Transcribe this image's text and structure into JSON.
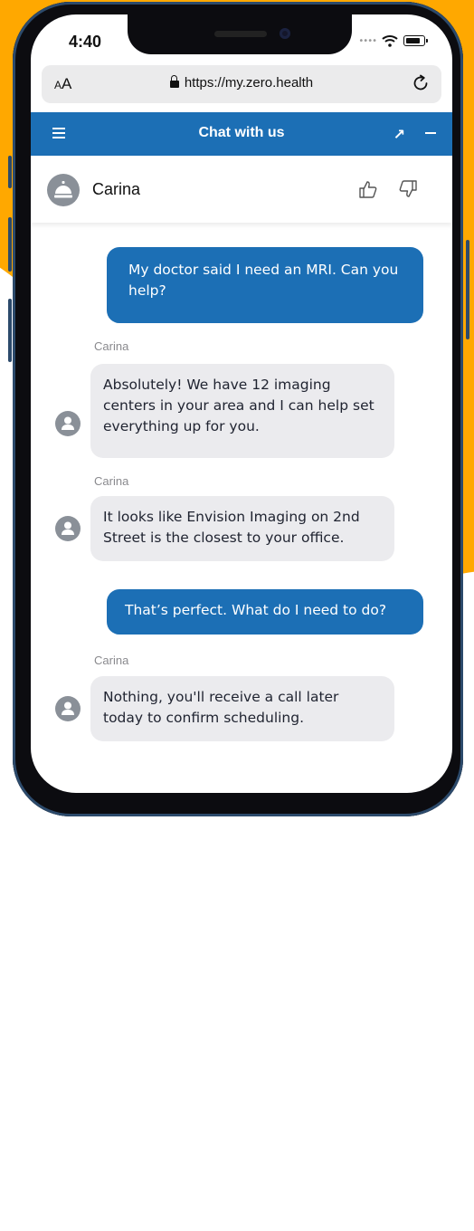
{
  "status_bar": {
    "time": "4:40"
  },
  "browser": {
    "text_size_label_small": "A",
    "text_size_label_large": "A",
    "url": "https://my.zero.health"
  },
  "chat_header": {
    "title": "Chat with us"
  },
  "agent": {
    "name": "Carina"
  },
  "messages": [
    {
      "from": "user",
      "text": "My doctor said I need an MRI. Can you help?"
    },
    {
      "from": "agent",
      "sender": "Carina",
      "text": "Absolutely! We have 12 imaging centers in your area and I can help set everything up for you."
    },
    {
      "from": "agent",
      "sender": "Carina",
      "text": "It looks like Envision Imaging on 2nd Street is the closest to your office."
    },
    {
      "from": "user",
      "text": "That’s perfect. What do I need to do?"
    },
    {
      "from": "agent",
      "sender": "Carina",
      "text": "Nothing, you'll receive a call later today to confirm scheduling."
    }
  ],
  "colors": {
    "background_accent": "#ffa800",
    "brand_blue": "#1c6fb5",
    "agent_bubble": "#ebebee",
    "phone_frame": "#2c4a6b"
  },
  "icons": [
    "menu-icon",
    "expand-icon",
    "minimize-icon",
    "lock-icon",
    "reload-icon",
    "service-bell-icon",
    "thumbs-up-icon",
    "thumbs-down-icon",
    "person-icon",
    "wifi-icon",
    "battery-icon"
  ]
}
